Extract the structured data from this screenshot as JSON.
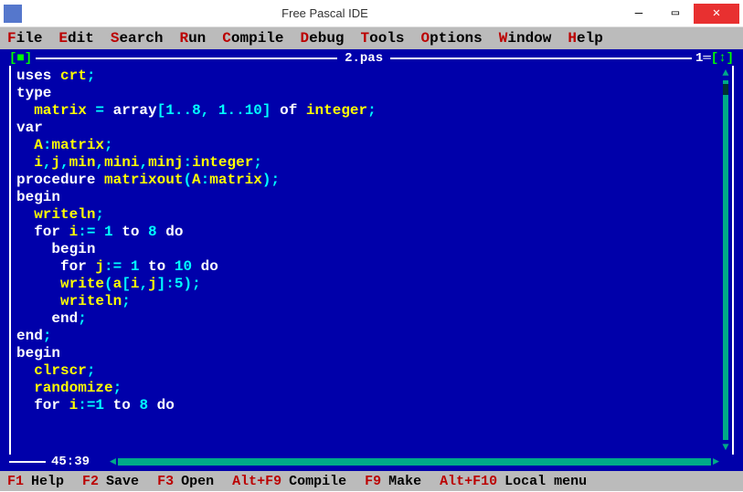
{
  "window": {
    "title": "Free Pascal IDE"
  },
  "menu": [
    {
      "hotkey": "F",
      "rest": "ile"
    },
    {
      "hotkey": "E",
      "rest": "dit"
    },
    {
      "hotkey": "S",
      "rest": "earch"
    },
    {
      "hotkey": "R",
      "rest": "un"
    },
    {
      "hotkey": "C",
      "rest": "ompile"
    },
    {
      "hotkey": "D",
      "rest": "ebug"
    },
    {
      "hotkey": "T",
      "rest": "ools"
    },
    {
      "hotkey": "O",
      "rest": "ptions"
    },
    {
      "hotkey": "W",
      "rest": "indow"
    },
    {
      "hotkey": "H",
      "rest": "elp"
    }
  ],
  "editor": {
    "frame_left": "[■]",
    "filename": "2.pas",
    "frame_right_num": "1",
    "frame_right_sym": "[↕]",
    "cursor_pos": "45:39",
    "code": [
      [
        [
          "kw",
          "uses "
        ],
        [
          "id",
          "crt"
        ],
        [
          "sym",
          ";"
        ]
      ],
      [
        [
          "kw",
          "type"
        ]
      ],
      [
        [
          "id",
          "  matrix "
        ],
        [
          "sym",
          "= "
        ],
        [
          "kw",
          "array"
        ],
        [
          "sym",
          "["
        ],
        [
          "num",
          "1"
        ],
        [
          "sym",
          ".."
        ],
        [
          "num",
          "8"
        ],
        [
          "sym",
          ", "
        ],
        [
          "num",
          "1"
        ],
        [
          "sym",
          ".."
        ],
        [
          "num",
          "10"
        ],
        [
          "sym",
          "] "
        ],
        [
          "kw",
          "of "
        ],
        [
          "id",
          "integer"
        ],
        [
          "sym",
          ";"
        ]
      ],
      [
        [
          "kw",
          "var"
        ]
      ],
      [
        [
          "id",
          "  A"
        ],
        [
          "sym",
          ":"
        ],
        [
          "id",
          "matrix"
        ],
        [
          "sym",
          ";"
        ]
      ],
      [
        [
          "id",
          "  i"
        ],
        [
          "sym",
          ","
        ],
        [
          "id",
          "j"
        ],
        [
          "sym",
          ","
        ],
        [
          "id",
          "min"
        ],
        [
          "sym",
          ","
        ],
        [
          "id",
          "mini"
        ],
        [
          "sym",
          ","
        ],
        [
          "id",
          "minj"
        ],
        [
          "sym",
          ":"
        ],
        [
          "id",
          "integer"
        ],
        [
          "sym",
          ";"
        ]
      ],
      [
        [
          "kw",
          "procedure "
        ],
        [
          "id",
          "matrixout"
        ],
        [
          "sym",
          "("
        ],
        [
          "id",
          "A"
        ],
        [
          "sym",
          ":"
        ],
        [
          "id",
          "matrix"
        ],
        [
          "sym",
          ");"
        ]
      ],
      [
        [
          "kw",
          "begin"
        ]
      ],
      [
        [
          "id",
          "  writeln"
        ],
        [
          "sym",
          ";"
        ]
      ],
      [
        [
          "kw",
          "  for "
        ],
        [
          "id",
          "i"
        ],
        [
          "sym",
          ":= "
        ],
        [
          "num",
          "1"
        ],
        [
          "kw",
          " to "
        ],
        [
          "num",
          "8"
        ],
        [
          "kw",
          " do"
        ]
      ],
      [
        [
          "kw",
          "    begin"
        ]
      ],
      [
        [
          "kw",
          "     for "
        ],
        [
          "id",
          "j"
        ],
        [
          "sym",
          ":= "
        ],
        [
          "num",
          "1"
        ],
        [
          "kw",
          " to "
        ],
        [
          "num",
          "10"
        ],
        [
          "kw",
          " do"
        ]
      ],
      [
        [
          "id",
          "     write"
        ],
        [
          "sym",
          "("
        ],
        [
          "id",
          "a"
        ],
        [
          "sym",
          "["
        ],
        [
          "id",
          "i"
        ],
        [
          "sym",
          ","
        ],
        [
          "id",
          "j"
        ],
        [
          "sym",
          "]:"
        ],
        [
          "num",
          "5"
        ],
        [
          "sym",
          ");"
        ]
      ],
      [
        [
          "id",
          "     writeln"
        ],
        [
          "sym",
          ";"
        ]
      ],
      [
        [
          "kw",
          "    end"
        ],
        [
          "sym",
          ";"
        ]
      ],
      [
        [
          "kw",
          "end"
        ],
        [
          "sym",
          ";"
        ]
      ],
      [
        [
          "kw",
          ""
        ]
      ],
      [
        [
          "kw",
          "begin"
        ]
      ],
      [
        [
          "id",
          "  clrscr"
        ],
        [
          "sym",
          ";"
        ]
      ],
      [
        [
          "id",
          "  randomize"
        ],
        [
          "sym",
          ";"
        ]
      ],
      [
        [
          "kw",
          "  for "
        ],
        [
          "id",
          "i"
        ],
        [
          "sym",
          ":="
        ],
        [
          "num",
          "1"
        ],
        [
          "kw",
          " to "
        ],
        [
          "num",
          "8"
        ],
        [
          "kw",
          " do"
        ]
      ]
    ]
  },
  "status": [
    {
      "key": "F1",
      "label": "Help"
    },
    {
      "key": "F2",
      "label": "Save"
    },
    {
      "key": "F3",
      "label": "Open"
    },
    {
      "key": "Alt+F9",
      "label": "Compile"
    },
    {
      "key": "F9",
      "label": "Make"
    },
    {
      "key": "Alt+F10",
      "label": "Local menu"
    }
  ]
}
